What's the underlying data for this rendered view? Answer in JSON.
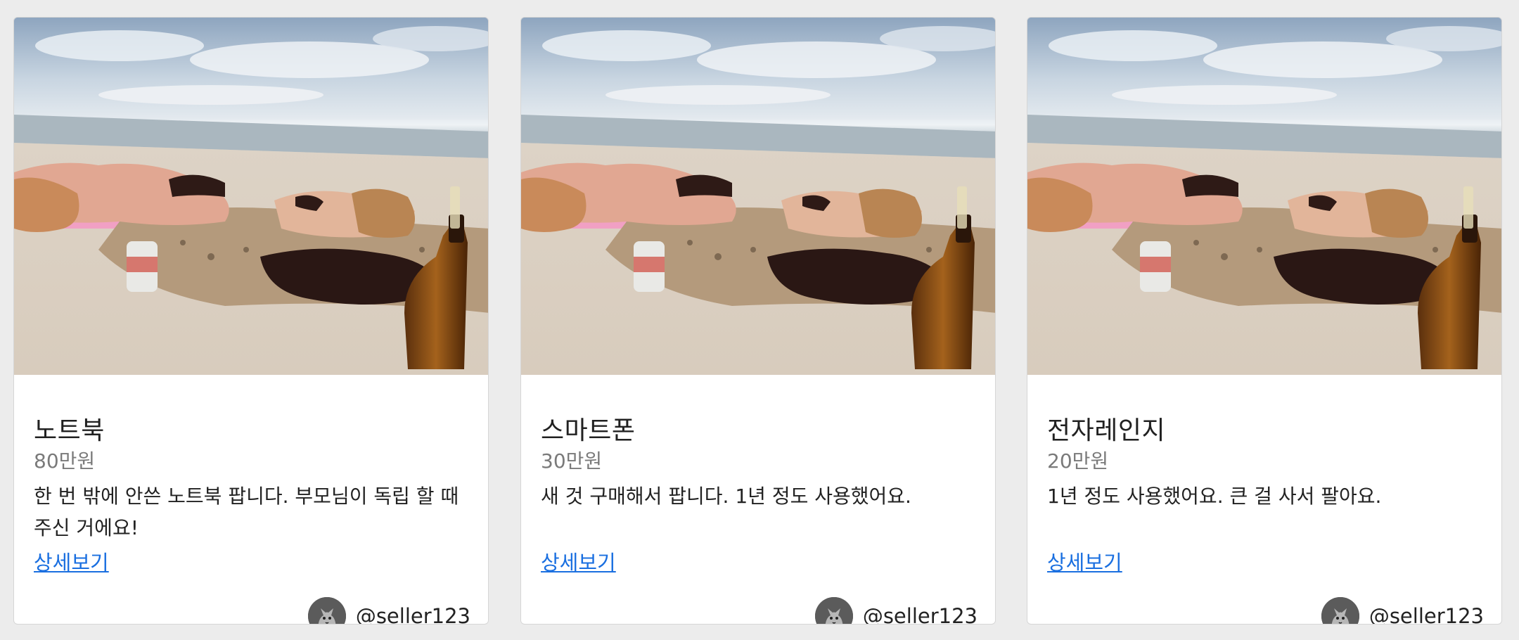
{
  "cards": [
    {
      "title": "노트북",
      "price": "80만원",
      "description": "한 번 밖에 안쓴 노트북 팝니다. 부모님이 독립 할 때 주신 거에요!",
      "link_label": "상세보기",
      "seller": "@seller123",
      "image_icon": "beach-photo",
      "avatar_icon": "cat-avatar"
    },
    {
      "title": "스마트폰",
      "price": "30만원",
      "description": "새 것 구매해서 팝니다. 1년 정도 사용했어요.",
      "link_label": "상세보기",
      "seller": "@seller123",
      "image_icon": "beach-photo",
      "avatar_icon": "cat-avatar"
    },
    {
      "title": "전자레인지",
      "price": "20만원",
      "description": "1년 정도 사용했어요. 큰 걸 사서 팔아요.",
      "link_label": "상세보기",
      "seller": "@seller123",
      "image_icon": "beach-photo",
      "avatar_icon": "cat-avatar"
    }
  ],
  "colors": {
    "background": "#ececec",
    "card": "#ffffff",
    "link": "#1a6fe0",
    "price": "#7a7a7a"
  }
}
